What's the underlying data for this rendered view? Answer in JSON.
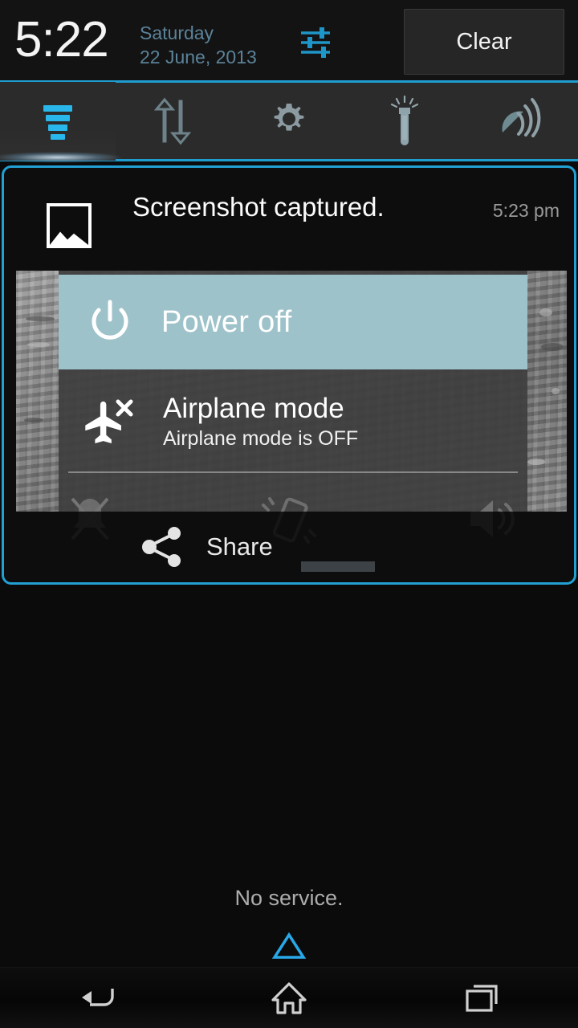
{
  "header": {
    "clock": "5:22",
    "day": "Saturday",
    "date": "22 June, 2013",
    "clear_label": "Clear",
    "settings_icon": "sliders-icon",
    "accent_color": "#22a0d4",
    "date_color": "#5b8299"
  },
  "quick_settings": {
    "items": [
      {
        "name": "notifications-tab",
        "icon": "notification-bars-icon",
        "active": true
      },
      {
        "name": "data-transfer-toggle",
        "icon": "data-arrows-icon",
        "active": false
      },
      {
        "name": "settings-shortcut",
        "icon": "gear-icon",
        "active": false
      },
      {
        "name": "flashlight-toggle",
        "icon": "flashlight-icon",
        "active": false
      },
      {
        "name": "gps-toggle",
        "icon": "gps-satellite-icon",
        "active": false
      }
    ]
  },
  "notification": {
    "icon": "photo-icon",
    "title": "Screenshot captured.",
    "time": "5:23 pm",
    "action_label": "Share",
    "action_icon": "share-icon",
    "preview": {
      "power_off_label": "Power off",
      "power_off_icon": "power-icon",
      "power_off_highlight": "#9ec2ca",
      "airplane_title": "Airplane mode",
      "airplane_subtitle": "Airplane mode is OFF",
      "airplane_icon": "airplane-off-icon",
      "ringer_icons": [
        "silent-bell-icon",
        "vibrate-icon",
        "volume-icon"
      ]
    }
  },
  "footer": {
    "status": "No service.",
    "collapse_icon": "collapse-triangle-icon",
    "collapse_color": "#28a8e8"
  },
  "navbar": {
    "buttons": [
      {
        "name": "back-button",
        "icon": "back-arrow-icon"
      },
      {
        "name": "home-button",
        "icon": "home-icon"
      },
      {
        "name": "recents-button",
        "icon": "recents-icon"
      }
    ]
  }
}
